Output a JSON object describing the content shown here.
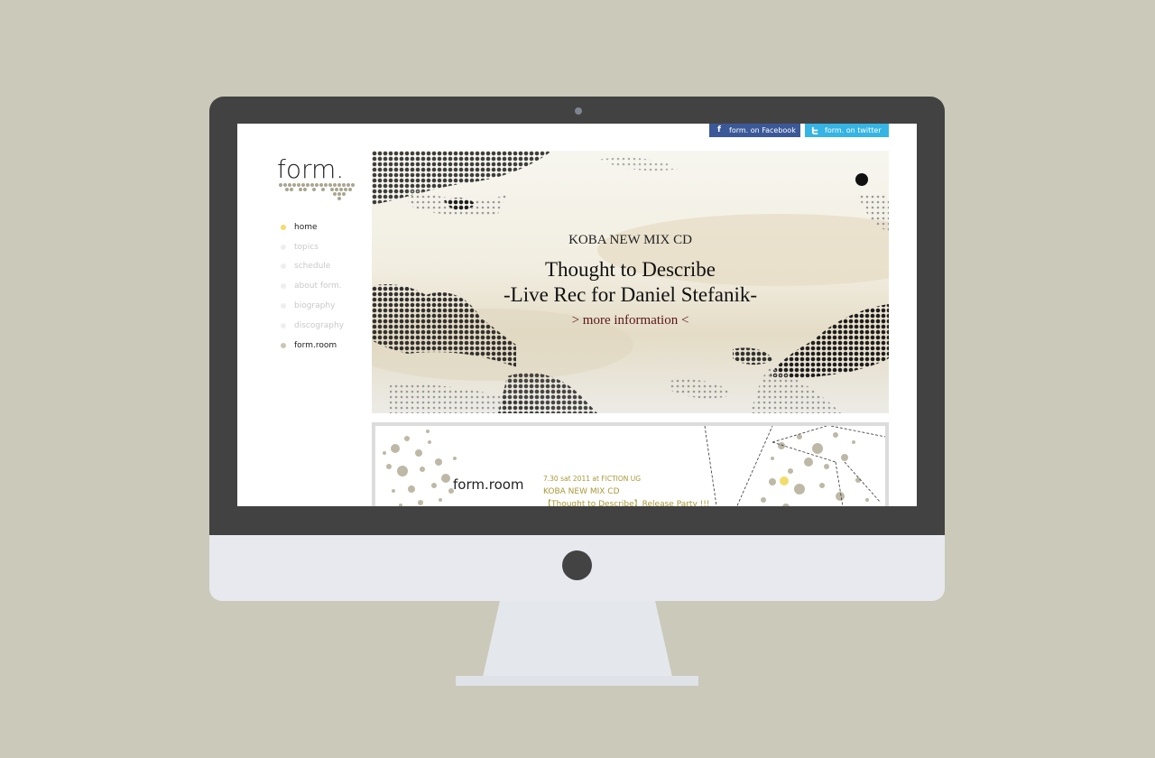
{
  "social": {
    "facebook_label": "form. on Facebook",
    "twitter_label": "form. on twitter"
  },
  "logo": {
    "text": "form."
  },
  "nav": {
    "items": [
      {
        "label": "home"
      },
      {
        "label": "topics"
      },
      {
        "label": "schedule"
      },
      {
        "label": "about form."
      },
      {
        "label": "biography"
      },
      {
        "label": "discography"
      },
      {
        "label": "form.room"
      }
    ]
  },
  "hero": {
    "subtitle": "KOBA NEW MIX CD",
    "title_line1": "Thought to Describe",
    "title_line2": "-Live Rec for Daniel Stefanik-",
    "link": "> more information <"
  },
  "banner": {
    "room_logo": "form.room",
    "date": "7.30 sat 2011 at FICTION UG",
    "line1": "KOBA NEW MIX CD",
    "line2": "【Thought to Describe】Release Party !!!"
  },
  "colors": {
    "background": "#cbc9b9",
    "facebook": "#3b5998",
    "twitter": "#35b4e5",
    "nav_active_bullet": "#f3dc6b",
    "accent_olive": "#a79838",
    "hero_link": "#5a1818"
  }
}
